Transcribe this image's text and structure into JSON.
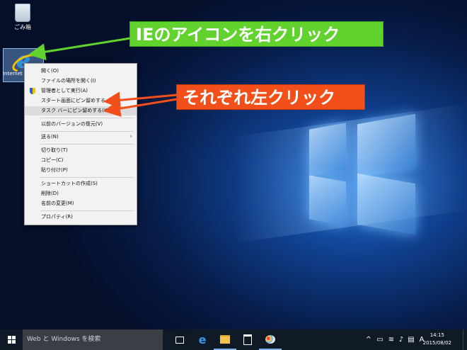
{
  "desktop": {
    "recycle_bin_label": "ごみ箱",
    "ie_label": "Internet Explorer"
  },
  "context_menu": {
    "items": [
      {
        "label": "開く(O)"
      },
      {
        "label": "ファイルの場所を開く(I)"
      },
      {
        "label": "管理者として実行(A)"
      },
      {
        "label": "スタート画面にピン留めする"
      },
      {
        "label": "タスク バーにピン留めする(K)"
      },
      {
        "label": "以前のバージョンの復元(V)"
      },
      {
        "label": "送る(N)"
      },
      {
        "label": "切り取り(T)"
      },
      {
        "label": "コピー(C)"
      },
      {
        "label": "貼り付け(P)"
      },
      {
        "label": "ショートカットの作成(S)"
      },
      {
        "label": "削除(D)"
      },
      {
        "label": "名前の変更(M)"
      },
      {
        "label": "プロパティ(R)"
      }
    ]
  },
  "callouts": {
    "green": "IEのアイコンを右クリック",
    "orange": "それぞれ左クリック"
  },
  "taskbar": {
    "search_placeholder": "Web と Windows を検索",
    "ime": "A",
    "time": "14:15",
    "date": "2015/08/02"
  },
  "colors": {
    "callout_green": "#62d22f",
    "callout_orange": "#f24f1a",
    "taskbar": "#101a26",
    "desktop_blue": "#0f3e8c"
  }
}
